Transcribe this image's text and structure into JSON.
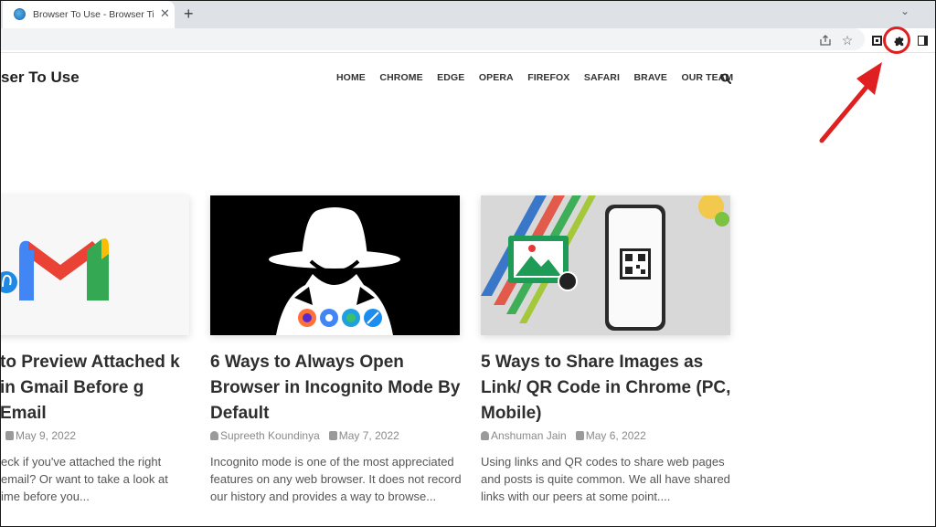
{
  "browser": {
    "tab_title": "Browser To Use - Browser Tips, Tr",
    "tab_close": "✕",
    "new_tab": "+",
    "tab_search": "⌄",
    "star": "☆"
  },
  "site": {
    "logo": "ser To Use",
    "nav": [
      "HOME",
      "CHROME",
      "EDGE",
      "OPERA",
      "FIREFOX",
      "SAFARI",
      "BRAVE",
      "OUR TEAM"
    ]
  },
  "colors": {
    "highlight": "#e02020",
    "accent_chrome_bar": "#dee1e6"
  },
  "icons": {
    "share": "share-icon",
    "star": "star-icon",
    "puzzle": "puzzle-icon",
    "search": "search-icon"
  },
  "articles": [
    {
      "title": "to Preview Attached k in Gmail Before g Email",
      "author": "",
      "date": "May 9, 2022",
      "excerpt": "eck if you've attached the right email? Or want to take a look at ime before you..."
    },
    {
      "title": "6 Ways to Always Open Browser in Incognito Mode By Default",
      "author": "Supreeth Koundinya",
      "date": "May 7, 2022",
      "excerpt": "Incognito mode is one of the most appreciated features on any web browser. It does not record our history and provides a way to browse..."
    },
    {
      "title": "5 Ways to Share Images as Link/ QR Code in Chrome (PC, Mobile)",
      "author": "Anshuman Jain",
      "date": "May 6, 2022",
      "excerpt": "Using links and QR codes to share web pages and posts is quite common. We all have shared links with our peers at some point...."
    }
  ]
}
